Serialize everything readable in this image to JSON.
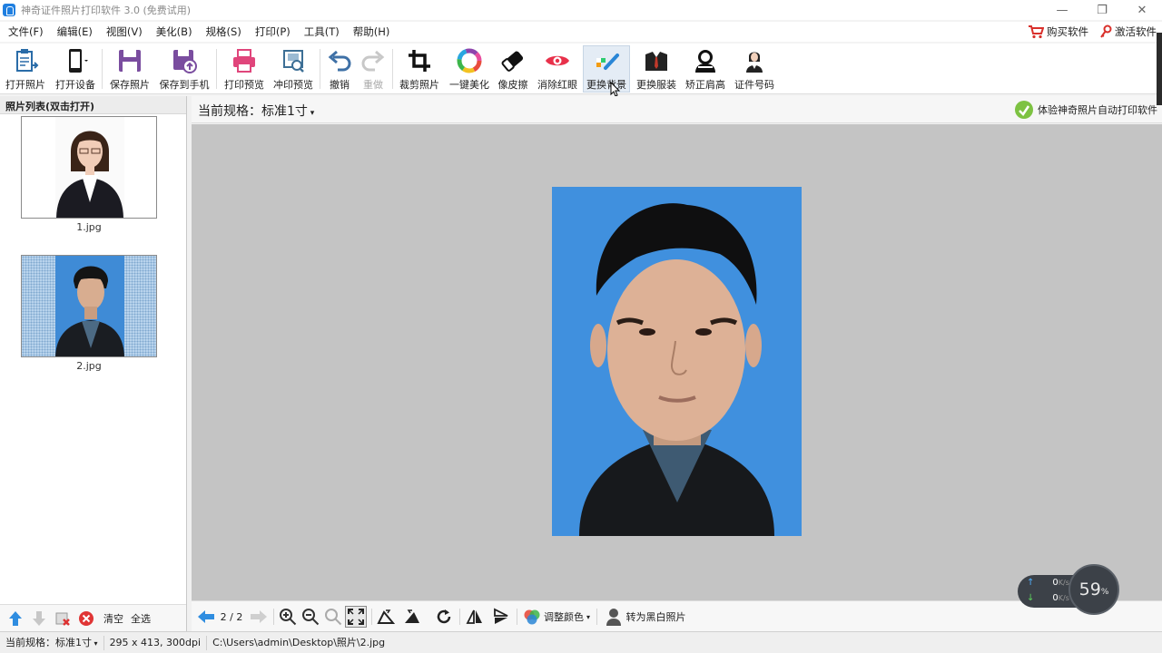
{
  "window": {
    "title": "神奇证件照片打印软件 3.0 (免费试用)",
    "minimize": "—",
    "restore": "❐",
    "close": "✕"
  },
  "menu": {
    "items": [
      "文件(F)",
      "编辑(E)",
      "视图(V)",
      "美化(B)",
      "规格(S)",
      "打印(P)",
      "工具(T)",
      "帮助(H)"
    ],
    "buy_label": "购买软件",
    "activate_label": "激活软件"
  },
  "toolbar": {
    "open_photo": "打开照片",
    "open_device": "打开设备",
    "save_photo": "保存照片",
    "save_to_phone": "保存到手机",
    "print_preview": "打印预览",
    "develop_preview": "冲印预览",
    "undo": "撤销",
    "redo": "重做",
    "crop": "裁剪照片",
    "beautify": "一键美化",
    "eraser": "像皮擦",
    "red_eye": "消除红眼",
    "change_bg": "更换背景",
    "change_clothes": "更换服装",
    "shoulder": "矫正肩高",
    "id_number": "证件号码"
  },
  "left_panel": {
    "title": "照片列表(双击打开)",
    "photos": [
      {
        "name": "1.jpg"
      },
      {
        "name": "2.jpg"
      }
    ],
    "clear": "清空",
    "select_all": "全选"
  },
  "spec": {
    "label": "当前规格：标准1寸",
    "auto_print": "体验神奇照片自动打印软件"
  },
  "bottom": {
    "page": "2 / 2",
    "adjust_color": "调整颜色",
    "to_bw": "转为黑白照片"
  },
  "status": {
    "spec_key": "当前规格：",
    "spec_value": "标准1寸",
    "dims": "295 x 413, 300dpi",
    "path": "C:\\Users\\admin\\Desktop\\照片\\2.jpg"
  },
  "speed_widget": {
    "up": "0",
    "down": "0",
    "unit": "K/s",
    "percent": "59",
    "percent_unit": "%"
  },
  "colors": {
    "photo_bg": "#4090de",
    "accent": "#1f7fe0"
  }
}
